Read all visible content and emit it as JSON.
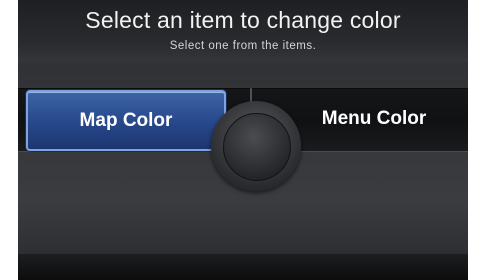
{
  "header": {
    "title": "Select an item to change color",
    "subtitle": "Select one from the items."
  },
  "items": [
    {
      "label": "Map Color",
      "selected": true
    },
    {
      "label": "Menu Color",
      "selected": false
    }
  ],
  "colors": {
    "selected_item": "#2c4e92",
    "screen_background": "#34363a",
    "text": "#ffffff"
  },
  "icons": {
    "center_control": "knob-icon"
  }
}
